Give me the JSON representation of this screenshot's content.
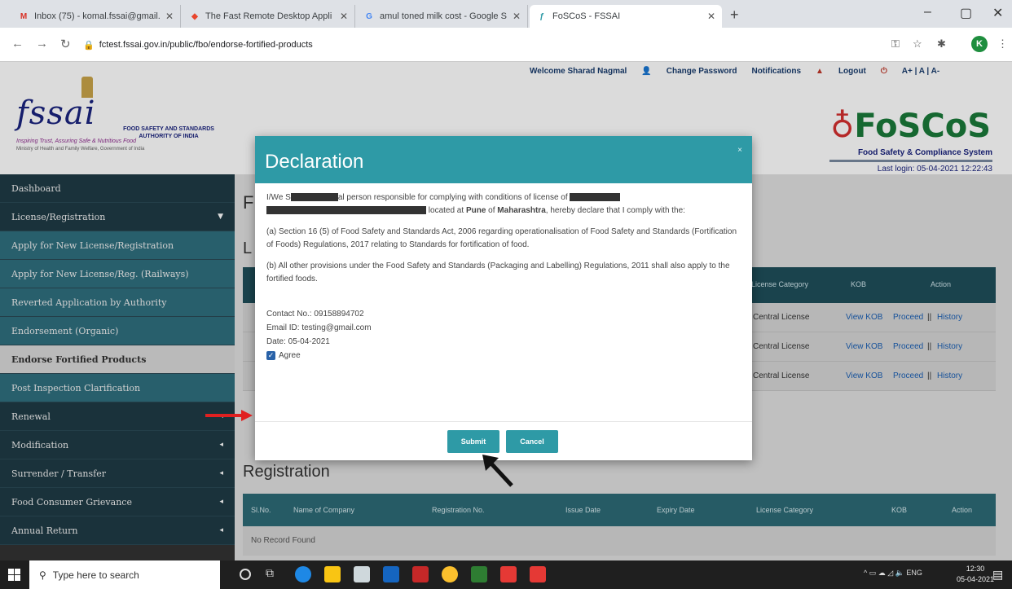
{
  "browser": {
    "tabs": [
      {
        "title": "Inbox (75) - komal.fssai@gmail.c",
        "favicon": "gmail-icon"
      },
      {
        "title": "The Fast Remote Desktop Appli",
        "favicon": "anydesk-icon"
      },
      {
        "title": "amul toned milk cost - Google S",
        "favicon": "google-icon"
      },
      {
        "title": "FoSCoS - FSSAI",
        "favicon": "fssai-icon"
      }
    ],
    "url": "fctest.fssai.gov.in/public/fbo/endorse-fortified-products",
    "profile_initial": "K"
  },
  "header": {
    "welcome": "Welcome Sharad Nagmal",
    "change_password": "Change Password",
    "notifications": "Notifications",
    "logout": "Logout",
    "font_sizes": "A+ | A | A-",
    "fssai_logo": "fssai",
    "authority": "FOOD SAFETY AND STANDARDS AUTHORITY OF INDIA",
    "tagline": "Inspiring Trust, Assuring Safe & Nutritious Food",
    "ministry": "Ministry of Health and Family Welfare, Government of India",
    "foscos_logo": "FoSCoS",
    "foscos_sub": "Food Safety & Compliance System",
    "last_login": "Last login: 05-04-2021 12:22:43"
  },
  "sidebar": {
    "items": [
      {
        "label": "Dashboard",
        "caret": false
      },
      {
        "label": "License/Registration",
        "caret": true
      },
      {
        "label": "Apply for New License/Registration",
        "caret": false
      },
      {
        "label": "Apply for New License/Reg. (Railways)",
        "caret": false
      },
      {
        "label": "Reverted Application by Authority",
        "caret": false
      },
      {
        "label": "Endorsement (Organic)",
        "caret": false
      },
      {
        "label": "Endorse Fortified Products",
        "caret": false
      },
      {
        "label": "Post Inspection Clarification",
        "caret": false
      },
      {
        "label": "Renewal",
        "caret": true
      },
      {
        "label": "Modification",
        "caret": true
      },
      {
        "label": "Surrender / Transfer",
        "caret": true
      },
      {
        "label": "Food Consumer Grievance",
        "caret": true
      },
      {
        "label": "Annual Return",
        "caret": true
      }
    ]
  },
  "main": {
    "title_letter": "F",
    "license_letter": "L",
    "license_table": {
      "headers": [
        "License Category",
        "KOB",
        "Action"
      ],
      "rows": [
        {
          "category": "Central License",
          "kob": "View KOB",
          "proceed": "Proceed",
          "history": "History"
        },
        {
          "category": "Central License",
          "kob": "View KOB",
          "proceed": "Proceed",
          "history": "History"
        },
        {
          "category": "Central License",
          "kob": "View KOB",
          "proceed": "Proceed",
          "history": "History"
        }
      ]
    },
    "registration": {
      "title": "Registration",
      "headers": [
        "Sl.No.",
        "Name of Company",
        "Registration No.",
        "Issue Date",
        "Expiry Date",
        "License Category",
        "KOB",
        "Action"
      ],
      "empty": "No Record Found"
    }
  },
  "modal": {
    "title": "Declaration",
    "close": "×",
    "intro_1": "I/We S",
    "intro_2": "al person responsible for complying with conditions of license of",
    "intro_3": "located at",
    "city": "Pune",
    "of": "of",
    "state": "Maharashtra",
    "intro_4": ", hereby declare that I comply with the:",
    "clause_a": "(a) Section 16 (5) of Food Safety and Standards Act, 2006 regarding operationalisation of Food Safety and Standards (Fortification of Foods) Regulations, 2017 relating to Standards for fortification of food.",
    "clause_b": "(b) All other provisions under the Food Safety and Standards (Packaging and Labelling) Regulations, 2011 shall also apply to the fortified foods.",
    "contact": "Contact No.: 09158894702",
    "email": "Email ID: testing@gmail.com",
    "date": "Date: 05-04-2021",
    "agree": "Agree",
    "agree_checked": true,
    "submit": "Submit",
    "cancel": "Cancel"
  },
  "taskbar": {
    "search_placeholder": "Type here to search",
    "language": "ENG",
    "time": "12:30",
    "date": "05-04-2021"
  },
  "colors": {
    "teal": "#2e9aa6",
    "sidebar_dark": "#1f3b45",
    "sidebar_sub": "#2f6f7e",
    "link": "#1a5fb4",
    "arrow_red": "#e02020"
  }
}
